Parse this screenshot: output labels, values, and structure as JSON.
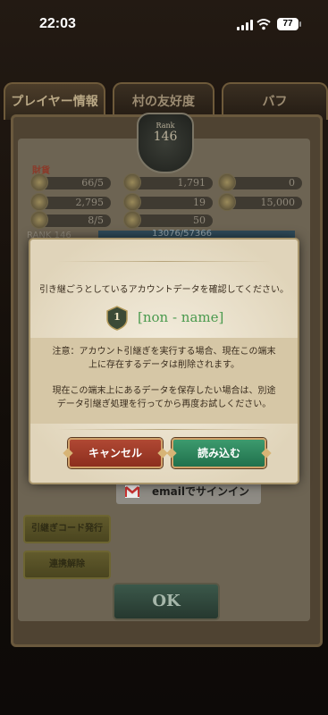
{
  "status_bar": {
    "time": "22:03",
    "battery": "77"
  },
  "background": {
    "tabs": [
      "プレイヤー情報",
      "村の友好度",
      "バフ"
    ],
    "rank_badge": {
      "label": "Rank",
      "value": "146"
    },
    "assets_label": "財貨",
    "resources": [
      "66/5",
      "1,791",
      "0",
      "2,795",
      "19",
      "15,000",
      "8/5",
      "50"
    ],
    "rank_row": {
      "label": "RANK 146",
      "progress_text": "13076/57366"
    },
    "side_buttons": [
      "引継ぎコード発行",
      "連携解除"
    ],
    "email_button": "emailでサインイン",
    "ok_button": "OK"
  },
  "dialog": {
    "message": "引き継ごうとしているアカウントデータを確認してください。",
    "level": "1",
    "account_name": "[non - name]",
    "warning_1": [
      "注意：アカウント引継ぎを実行する場合、現在この端末",
      "上に存在するデータは削除されます。"
    ],
    "warning_2": [
      "現在この端末上にあるデータを保存したい場合は、別途",
      "データ引継ぎ処理を行ってから再度お試しください。"
    ],
    "cancel_label": "キャンセル",
    "load_label": "読み込む"
  },
  "colors": {
    "accent_green": "#4a9a4e",
    "cancel_red": "#9c3a27",
    "load_green": "#2f8a5e"
  }
}
